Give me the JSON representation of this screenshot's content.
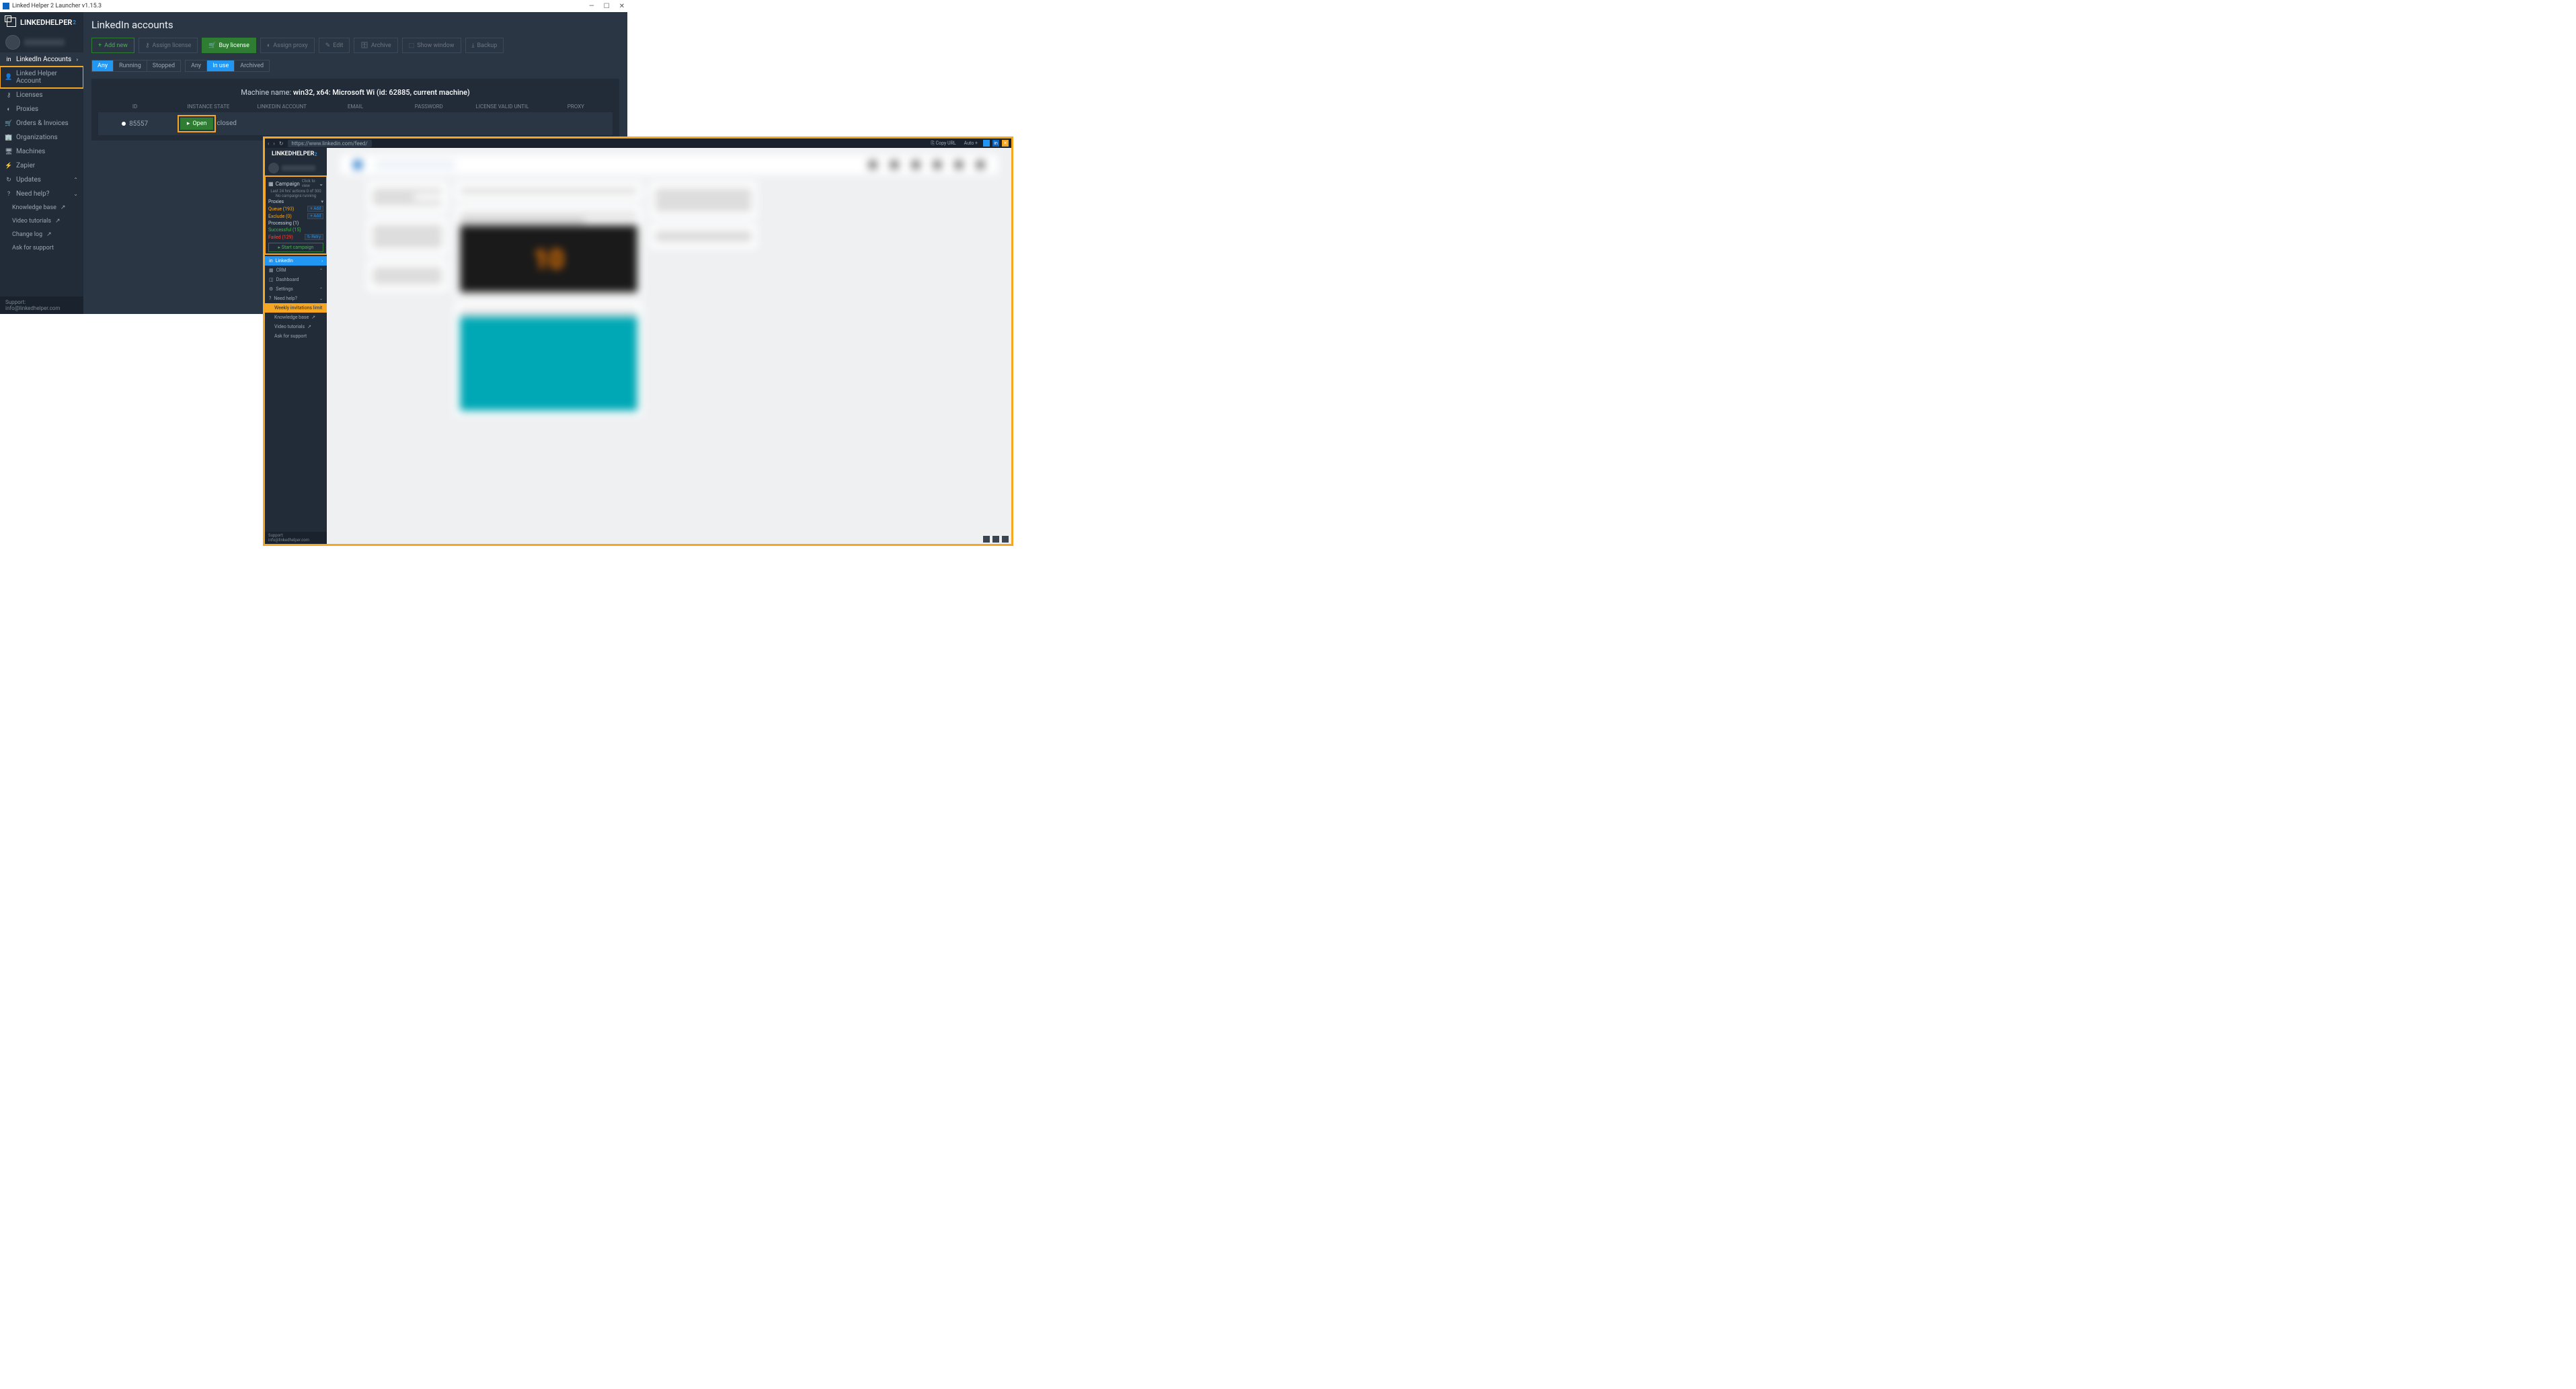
{
  "titlebar": {
    "title": "Linked Helper 2 Launcher v1.15.3"
  },
  "logo": "LINKEDHELPER",
  "nav": {
    "linkedin_accounts": "LinkedIn Accounts",
    "lh_account": "Linked Helper Account",
    "licenses": "Licenses",
    "proxies": "Proxies",
    "orders": "Orders & Invoices",
    "orgs": "Organizations",
    "machines": "Machines",
    "zapier": "Zapier",
    "updates": "Updates",
    "need_help": "Need help?",
    "kb": "Knowledge base",
    "videos": "Video tutorials",
    "changelog": "Change log",
    "ask": "Ask for support"
  },
  "support_email": "Support: info@linkedhelper.com",
  "page_title": "LinkedIn accounts",
  "toolbar": {
    "add": "Add new",
    "assign_license": "Assign license",
    "buy": "Buy license",
    "assign_proxy": "Assign proxy",
    "edit": "Edit",
    "archive": "Archive",
    "show_window": "Show window",
    "backup": "Backup"
  },
  "filters": {
    "g1": [
      "Any",
      "Running",
      "Stopped"
    ],
    "g2": [
      "Any",
      "In use",
      "Archived"
    ]
  },
  "machine_line": {
    "label": "Machine name:",
    "value": "win32, x64: Microsoft Wi",
    "suffix": "(id: 62885, current machine)"
  },
  "thead": [
    "ID",
    "INSTANCE STATE",
    "LINKEDIN ACCOUNT",
    "EMAIL",
    "PASSWORD",
    "LICENSE VALID UNTIL",
    "PROXY"
  ],
  "row": {
    "id": "85557",
    "open": "Open",
    "state": "closed"
  },
  "win2": {
    "url": "https://www.linkedin.com/feed/",
    "copy": "Copy URL",
    "auto": "Auto",
    "campaign": {
      "title": "Campaign",
      "click": "Click to view",
      "stats": "Last 24 hrs' actions 0 of 300",
      "nocamp": "No campaigns running",
      "proxies": "Proxies",
      "queue": "Queue (193)",
      "exclude": "Exclude (0)",
      "processing": "Processing (1)",
      "successful": "Successful (15)",
      "failed": "Failed (129)",
      "add": "Add",
      "retry": "Retry",
      "start": "Start campaign"
    },
    "nav2": {
      "linkedin": "LinkedIn",
      "crm": "CRM",
      "dashboard": "Dashboard",
      "settings": "Settings",
      "need_help": "Need help?",
      "weekly": "Weekly invitations limit",
      "kb": "Knowledge base",
      "videos": "Video tutorials",
      "ask": "Ask for support"
    },
    "vid_num": "10"
  }
}
